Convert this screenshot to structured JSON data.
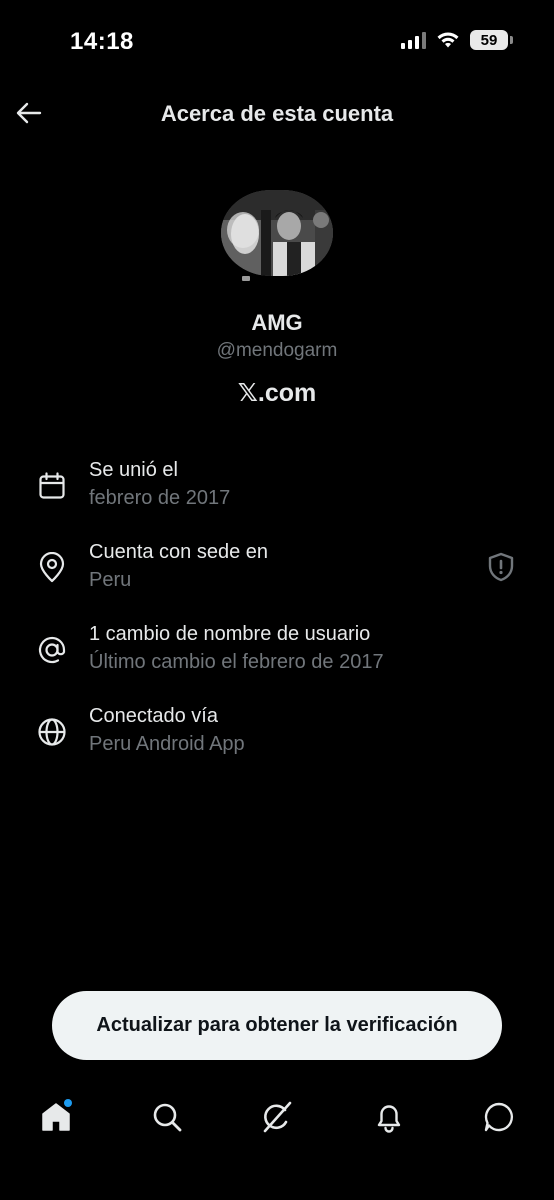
{
  "status_bar": {
    "time": "14:18",
    "battery_level": "59"
  },
  "header": {
    "title": "Acerca de esta cuenta",
    "back_icon": "arrow-left-icon"
  },
  "profile": {
    "display_name": "AMG",
    "handle": "@mendogarm",
    "platform": "𝕏.com"
  },
  "info": [
    {
      "icon": "calendar-icon",
      "title": "Se unió el",
      "subtitle": "febrero de 2017"
    },
    {
      "icon": "location-pin-icon",
      "title": "Cuenta con sede en",
      "subtitle": "Peru",
      "badge_icon": "shield-alert-icon"
    },
    {
      "icon": "at-sign-icon",
      "title": "1 cambio de nombre de usuario",
      "subtitle": "Último cambio el febrero de 2017"
    },
    {
      "icon": "globe-icon",
      "title": "Conectado vía",
      "subtitle": "Peru Android App"
    }
  ],
  "upsell": {
    "label": "Actualizar para obtener la verificación"
  },
  "nav": {
    "items": [
      "home-icon",
      "search-icon",
      "grok-icon",
      "bell-icon",
      "messages-icon"
    ],
    "active": "home-icon",
    "notification_dot_color": "#1d9bf0"
  },
  "colors": {
    "background": "#000000",
    "primary_text": "#e7e9ea",
    "secondary_text": "#71767b",
    "button_bg": "#eff3f4"
  }
}
